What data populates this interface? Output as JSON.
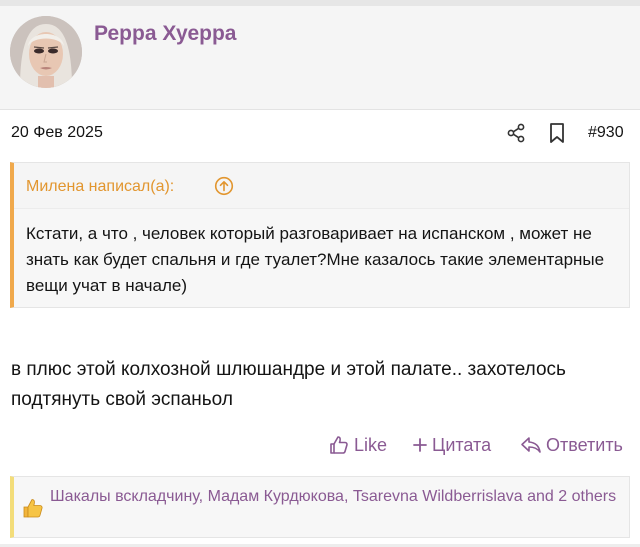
{
  "author": {
    "username": "Рерра Хуерра",
    "avatar_icon": "avatar-portrait"
  },
  "post": {
    "date": "20 Фев 2025",
    "number": "#930",
    "share_icon": "share-icon",
    "bookmark_icon": "bookmark-icon"
  },
  "quote": {
    "author_label": "Милена написал(а):",
    "text": "Кстати, а что , человек который разговаривает на испанском , может не знать как будет спальня и где туалет?Мне казалось такие элементарные вещи учат в начале)",
    "accent": "#f0a94c"
  },
  "message": {
    "text": "в плюс этой колхозной шлюшандре и этой палате.. захотелось подтянуть свой эспаньол"
  },
  "actions": {
    "like_label": "Like",
    "quote_label": "Цитата",
    "reply_label": "Ответить"
  },
  "reactions": {
    "text": "Шакалы вскладчину, Мадам Курдюкова, Tsarevna Wildberrislava and 2 others",
    "emoji_icon": "thumbs-up-emoji"
  },
  "colors": {
    "brand": "#8a5a93",
    "quote_author": "#e2962f",
    "reaction_bar": "#f3dd7a"
  }
}
